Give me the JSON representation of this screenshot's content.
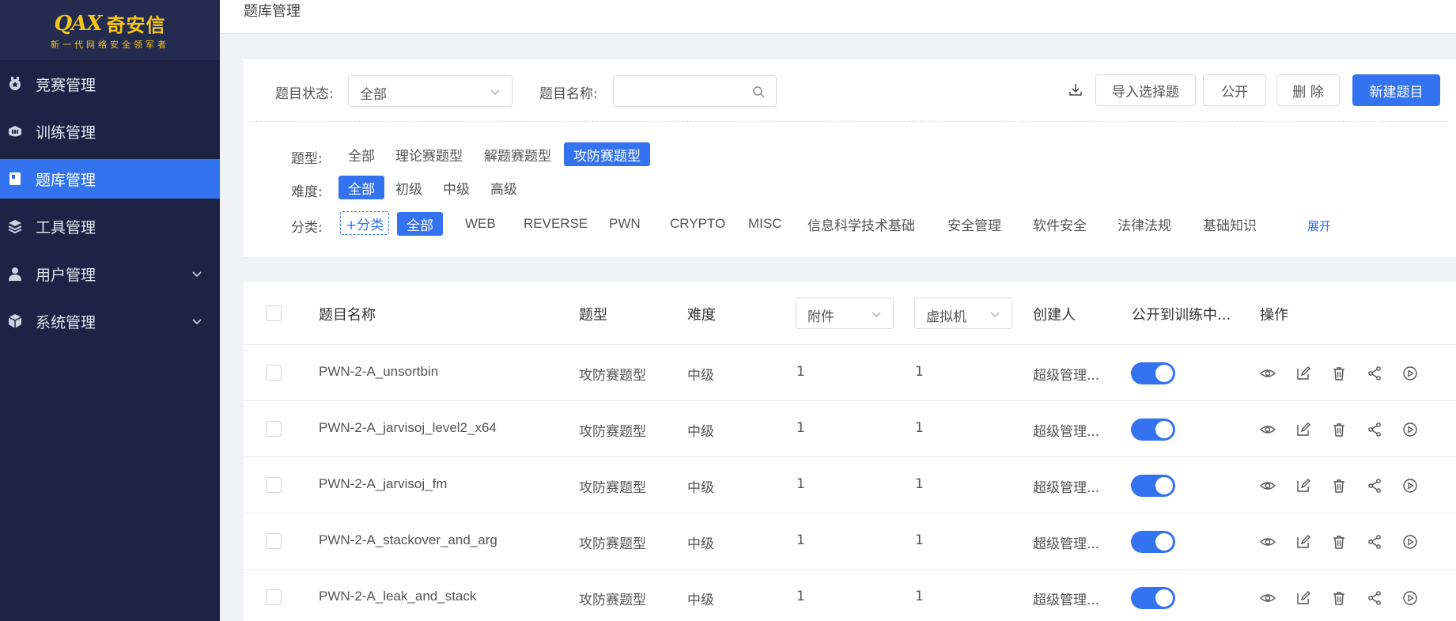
{
  "brand": {
    "name": "奇安信",
    "mark": "QAX",
    "tagline": "新一代网络安全领军者"
  },
  "sidebar": {
    "items": [
      {
        "label": "竞赛管理",
        "icon": "medal-icon"
      },
      {
        "label": "训练管理",
        "icon": "training-icon"
      },
      {
        "label": "题库管理",
        "icon": "book-icon",
        "active": true
      },
      {
        "label": "工具管理",
        "icon": "layers-icon"
      },
      {
        "label": "用户管理",
        "icon": "user-icon",
        "expandable": true
      },
      {
        "label": "系统管理",
        "icon": "cube-icon",
        "expandable": true
      }
    ]
  },
  "header": {
    "title": "题库管理"
  },
  "filters": {
    "status_label": "题目状态:",
    "status_value": "全部",
    "name_label": "题目名称:",
    "name_placeholder": "",
    "type_label": "题型:",
    "types": [
      "全部",
      "理论赛题型",
      "解题赛题型",
      "攻防赛题型"
    ],
    "type_selected": "攻防赛题型",
    "difficulty_label": "难度:",
    "difficulties": [
      "全部",
      "初级",
      "中级",
      "高级"
    ],
    "difficulty_selected": "全部",
    "category_label": "分类:",
    "add_category": "+分类",
    "categories": [
      "全部",
      "WEB",
      "REVERSE",
      "PWN",
      "CRYPTO",
      "MISC",
      "信息科学技术基础",
      "安全管理",
      "软件安全",
      "法律法规",
      "基础知识"
    ],
    "category_selected": "全部",
    "expand": "展开"
  },
  "toolbar": {
    "import": "导入选择题",
    "public": "公开",
    "delete": "删 除",
    "create": "新建题目"
  },
  "table": {
    "headers": {
      "name": "题目名称",
      "type": "题型",
      "difficulty": "难度",
      "attachment": "附件",
      "vm": "虚拟机",
      "creator": "创建人",
      "public": "公开到训练中...",
      "actions": "操作"
    },
    "rows": [
      {
        "name": "PWN-2-A_unsortbin",
        "type": "攻防赛题型",
        "difficulty": "中级",
        "attachment": "1",
        "vm": "1",
        "creator": "超级管理...",
        "public": true
      },
      {
        "name": "PWN-2-A_jarvisoj_level2_x64",
        "type": "攻防赛题型",
        "difficulty": "中级",
        "attachment": "1",
        "vm": "1",
        "creator": "超级管理...",
        "public": true
      },
      {
        "name": "PWN-2-A_jarvisoj_fm",
        "type": "攻防赛题型",
        "difficulty": "中级",
        "attachment": "1",
        "vm": "1",
        "creator": "超级管理...",
        "public": true
      },
      {
        "name": "PWN-2-A_stackover_and_arg",
        "type": "攻防赛题型",
        "difficulty": "中级",
        "attachment": "1",
        "vm": "1",
        "creator": "超级管理...",
        "public": true
      },
      {
        "name": "PWN-2-A_leak_and_stack",
        "type": "攻防赛题型",
        "difficulty": "中级",
        "attachment": "1",
        "vm": "1",
        "creator": "超级管理...",
        "public": true
      }
    ],
    "row_actions": [
      "eye-icon",
      "edit-icon",
      "trash-icon",
      "share-icon",
      "play-icon"
    ]
  },
  "colors": {
    "sidebar": "#1c2344",
    "accent": "#3373f0"
  }
}
